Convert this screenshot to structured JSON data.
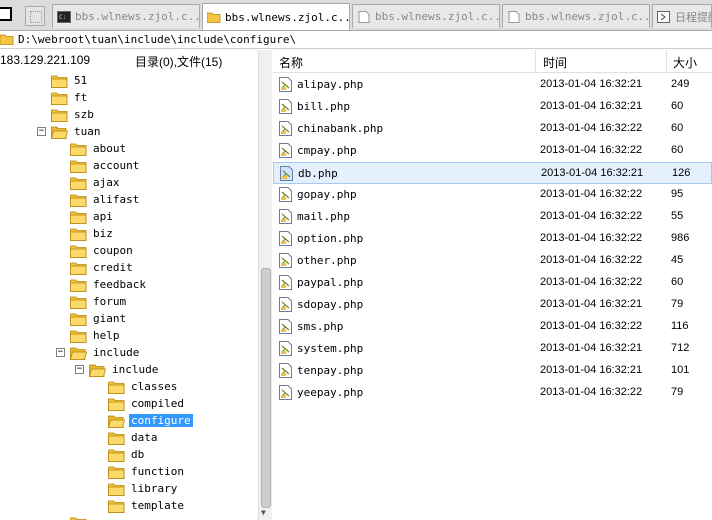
{
  "tabs": [
    {
      "label": "bbs.wlnews.zjol.c...",
      "icon": "terminal-icon",
      "active": false
    },
    {
      "label": "bbs.wlnews.zjol.c...",
      "icon": "folder-icon",
      "active": true
    },
    {
      "label": "bbs.wlnews.zjol.c...",
      "icon": "document-icon",
      "active": false
    },
    {
      "label": "bbs.wlnews.zjol.c...",
      "icon": "document-icon",
      "active": false
    },
    {
      "label": "日程提醒",
      "icon": "calendar-icon",
      "active": false
    }
  ],
  "path": "D:\\webroot\\tuan\\include\\include\\configure\\",
  "left": {
    "ip": "183.129.221.109",
    "count": "目录(0),文件(15)"
  },
  "tree": [
    {
      "label": "51",
      "depth": 2
    },
    {
      "label": "ft",
      "depth": 2
    },
    {
      "label": "szb",
      "depth": 2
    },
    {
      "label": "tuan",
      "depth": 2,
      "expander": "−",
      "open": true
    },
    {
      "label": "about",
      "depth": 3
    },
    {
      "label": "account",
      "depth": 3
    },
    {
      "label": "ajax",
      "depth": 3
    },
    {
      "label": "alifast",
      "depth": 3
    },
    {
      "label": "api",
      "depth": 3
    },
    {
      "label": "biz",
      "depth": 3
    },
    {
      "label": "coupon",
      "depth": 3
    },
    {
      "label": "credit",
      "depth": 3
    },
    {
      "label": "feedback",
      "depth": 3
    },
    {
      "label": "forum",
      "depth": 3
    },
    {
      "label": "giant",
      "depth": 3
    },
    {
      "label": "help",
      "depth": 3
    },
    {
      "label": "include",
      "depth": 3,
      "expander": "−",
      "open": true
    },
    {
      "label": "include",
      "depth": 4,
      "expander": "−",
      "open": true
    },
    {
      "label": "classes",
      "depth": 5
    },
    {
      "label": "compiled",
      "depth": 5
    },
    {
      "label": "configure",
      "depth": 5,
      "selected": true,
      "open": true
    },
    {
      "label": "data",
      "depth": 5
    },
    {
      "label": "db",
      "depth": 5
    },
    {
      "label": "function",
      "depth": 5
    },
    {
      "label": "library",
      "depth": 5
    },
    {
      "label": "template",
      "depth": 5
    }
  ],
  "columns": {
    "name": "名称",
    "time": "时间",
    "size": "大小"
  },
  "files": [
    {
      "name": "alipay.php",
      "time": "2013-01-04 16:32:21",
      "size": "249"
    },
    {
      "name": "bill.php",
      "time": "2013-01-04 16:32:21",
      "size": "60"
    },
    {
      "name": "chinabank.php",
      "time": "2013-01-04 16:32:22",
      "size": "60"
    },
    {
      "name": "cmpay.php",
      "time": "2013-01-04 16:32:22",
      "size": "60"
    },
    {
      "name": "db.php",
      "time": "2013-01-04 16:32:21",
      "size": "126",
      "selected": true
    },
    {
      "name": "gopay.php",
      "time": "2013-01-04 16:32:22",
      "size": "95"
    },
    {
      "name": "mail.php",
      "time": "2013-01-04 16:32:22",
      "size": "55"
    },
    {
      "name": "option.php",
      "time": "2013-01-04 16:32:22",
      "size": "986"
    },
    {
      "name": "other.php",
      "time": "2013-01-04 16:32:22",
      "size": "45"
    },
    {
      "name": "paypal.php",
      "time": "2013-01-04 16:32:22",
      "size": "60"
    },
    {
      "name": "sdopay.php",
      "time": "2013-01-04 16:32:21",
      "size": "79"
    },
    {
      "name": "sms.php",
      "time": "2013-01-04 16:32:22",
      "size": "116"
    },
    {
      "name": "system.php",
      "time": "2013-01-04 16:32:21",
      "size": "712"
    },
    {
      "name": "tenpay.php",
      "time": "2013-01-04 16:32:21",
      "size": "101"
    },
    {
      "name": "yeepay.php",
      "time": "2013-01-04 16:32:22",
      "size": "79"
    }
  ],
  "colors": {
    "selection": "#3399ff",
    "folder": "#f5c542",
    "row_select": "#e5f0ff"
  }
}
